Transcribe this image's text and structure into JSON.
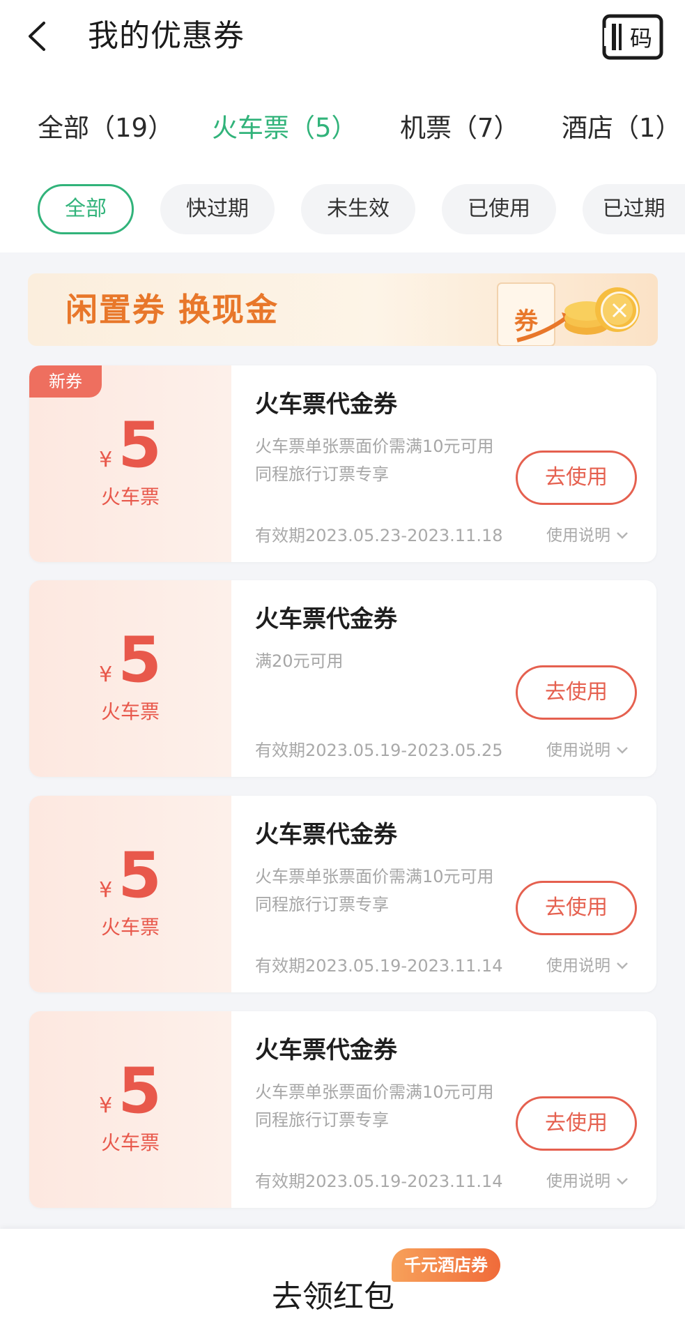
{
  "header": {
    "title": "我的优惠券",
    "code_icon_label": "码"
  },
  "category_tabs": [
    {
      "label": "全部（19）",
      "active": false
    },
    {
      "label": "火车票（5）",
      "active": true
    },
    {
      "label": "机票（7）",
      "active": false
    },
    {
      "label": "酒店（1）",
      "active": false
    }
  ],
  "filters": [
    {
      "label": "全部",
      "active": true
    },
    {
      "label": "快过期",
      "active": false
    },
    {
      "label": "未生效",
      "active": false
    },
    {
      "label": "已使用",
      "active": false
    },
    {
      "label": "已过期",
      "active": false
    }
  ],
  "banner": {
    "text": "闲置券 换现金",
    "ticket_label": "券"
  },
  "coupons": [
    {
      "badge": "新券",
      "currency": "¥",
      "amount": "5",
      "type": "火车票",
      "title": "火车票代金券",
      "desc_line1": "火车票单张票面价需满10元可用",
      "desc_line2": "同程旅行订票专享",
      "button": "去使用",
      "validity": "有效期2023.05.23-2023.11.18",
      "instructions": "使用说明"
    },
    {
      "badge": "",
      "currency": "¥",
      "amount": "5",
      "type": "火车票",
      "title": "火车票代金券",
      "desc_line1": "满20元可用",
      "desc_line2": "",
      "button": "去使用",
      "validity": "有效期2023.05.19-2023.05.25",
      "instructions": "使用说明"
    },
    {
      "badge": "",
      "currency": "¥",
      "amount": "5",
      "type": "火车票",
      "title": "火车票代金券",
      "desc_line1": "火车票单张票面价需满10元可用",
      "desc_line2": "同程旅行订票专享",
      "button": "去使用",
      "validity": "有效期2023.05.19-2023.11.14",
      "instructions": "使用说明"
    },
    {
      "badge": "",
      "currency": "¥",
      "amount": "5",
      "type": "火车票",
      "title": "火车票代金券",
      "desc_line1": "火车票单张票面价需满10元可用",
      "desc_line2": "同程旅行订票专享",
      "button": "去使用",
      "validity": "有效期2023.05.19-2023.11.14",
      "instructions": "使用说明"
    }
  ],
  "bottom": {
    "button": "去领红包",
    "badge": "千元酒店券"
  },
  "colors": {
    "accent_green": "#31b37a",
    "coupon_red": "#e8584b",
    "banner_orange": "#e8772a"
  }
}
